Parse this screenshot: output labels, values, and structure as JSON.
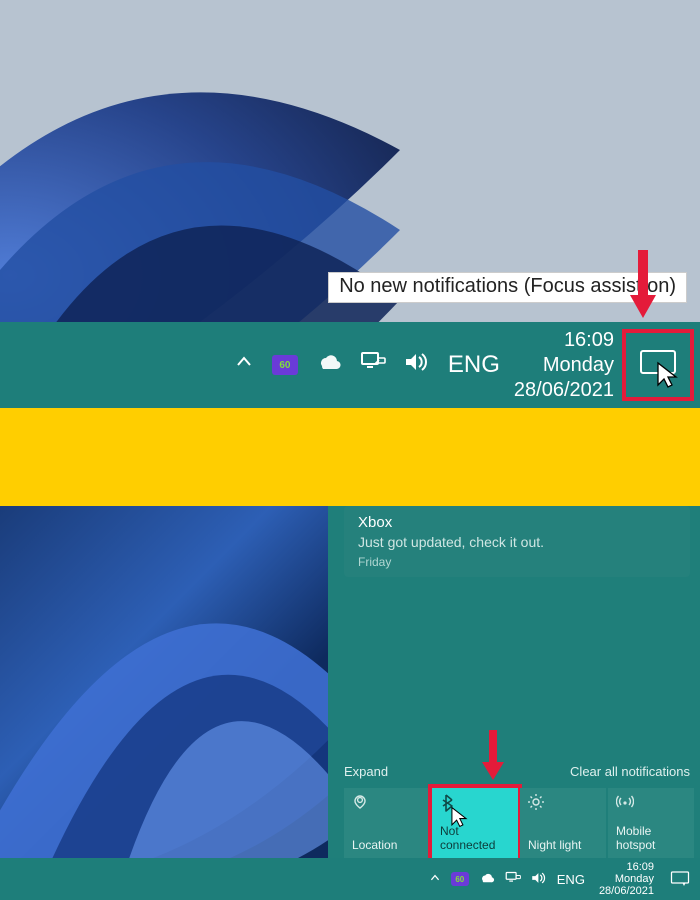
{
  "tooltip_text": "No new notifications (Focus assist on)",
  "taskbar1": {
    "language": "ENG",
    "nvidia_badge": "60",
    "clock_time": "16:09",
    "clock_day": "Monday",
    "clock_date": "28/06/2021"
  },
  "action_center": {
    "notification": {
      "title": "Xbox",
      "body": "Just got updated, check it out.",
      "when": "Friday"
    },
    "expand_label": "Expand",
    "clear_label": "Clear all notifications",
    "quick_actions": {
      "location": {
        "label": "Location"
      },
      "bluetooth": {
        "label": "Not connected"
      },
      "night_light": {
        "label": "Night light"
      },
      "mobile_hotspot": {
        "label": "Mobile hotspot"
      }
    }
  },
  "taskbar2": {
    "language": "ENG",
    "nvidia_badge": "60",
    "clock_time": "16:09",
    "clock_day": "Monday",
    "clock_date": "28/06/2021"
  }
}
